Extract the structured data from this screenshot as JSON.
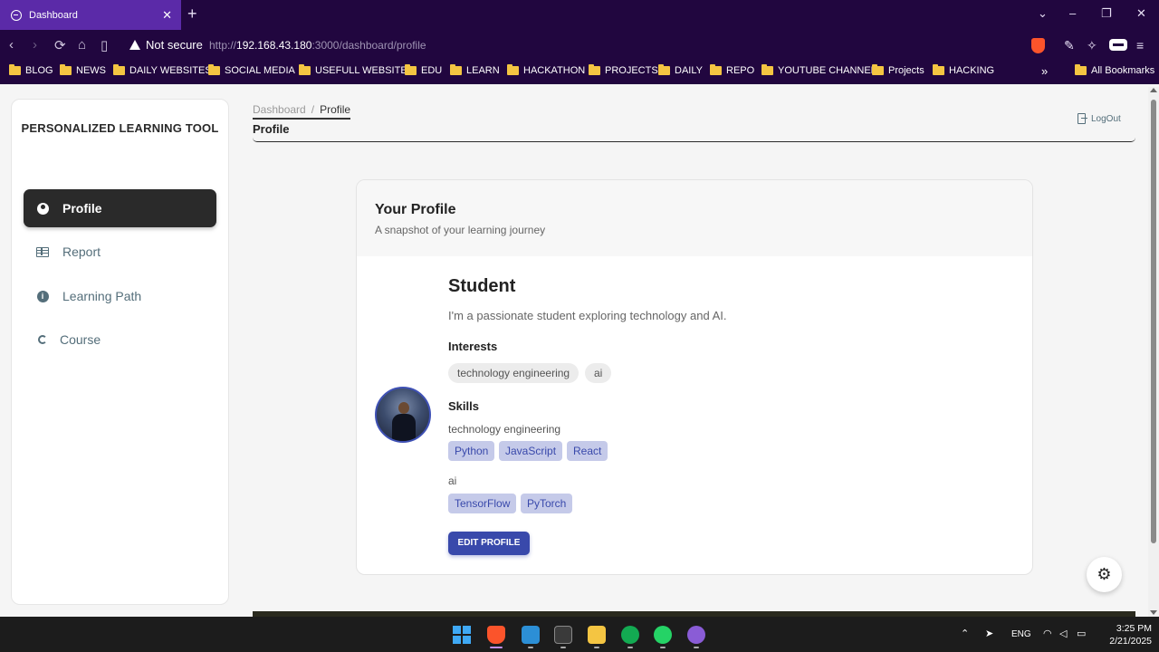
{
  "browser": {
    "tab_title": "Dashboard",
    "tab_close": "✕",
    "new_tab": "+",
    "security_label": "Not secure",
    "url_scheme": "http://",
    "url_host": "192.168.43.180",
    "url_rest": ":3000/dashboard/profile",
    "window_controls": [
      "⌄",
      "–",
      "❐",
      "✕"
    ]
  },
  "bookmarks": [
    "BLOG",
    "NEWS",
    "DAILY WEBSITES",
    "SOCIAL MEDIA",
    "USEFULL WEBSITES",
    "EDU",
    "LEARN",
    "HACKATHON",
    "PROJECTS",
    "DAILY",
    "REPO",
    "YOUTUBE CHANNEL",
    "Projects",
    "HACKING"
  ],
  "bookmarks_more": "»",
  "all_bookmarks": "All Bookmarks",
  "sidebar": {
    "brand": "PERSONALIZED LEARNING TOOL",
    "items": [
      {
        "label": "Profile",
        "icon": "person-icon",
        "active": true
      },
      {
        "label": "Report",
        "icon": "table-icon",
        "active": false
      },
      {
        "label": "Learning Path",
        "icon": "info-icon",
        "active": false
      },
      {
        "label": "Course",
        "icon": "cycle-icon",
        "active": false
      }
    ]
  },
  "header": {
    "breadcrumb_root": "Dashboard",
    "breadcrumb_sep": "/",
    "breadcrumb_current": "Profile",
    "title": "Profile",
    "logout": "LogOut"
  },
  "profile": {
    "card_title": "Your Profile",
    "card_subtitle": "A snapshot of your learning journey",
    "name": "Student",
    "bio": "I'm a passionate student exploring technology and AI.",
    "interests_title": "Interests",
    "interests": [
      "technology engineering",
      "ai"
    ],
    "skills_title": "Skills",
    "skill_groups": [
      {
        "name": "technology engineering",
        "skills": [
          "Python",
          "JavaScript",
          "React"
        ]
      },
      {
        "name": "ai",
        "skills": [
          "TensorFlow",
          "PyTorch"
        ]
      }
    ],
    "edit_button": "EDIT PROFILE"
  },
  "taskbar": {
    "lang": "ENG",
    "time": "3:25 PM",
    "date": "2/21/2025"
  },
  "colors": {
    "chrome": "#21063f",
    "active_tab": "#5b2aa8",
    "accent": "#3949ab",
    "skill_chip": "#c5cae9",
    "nav_active": "#2a2a2a"
  }
}
